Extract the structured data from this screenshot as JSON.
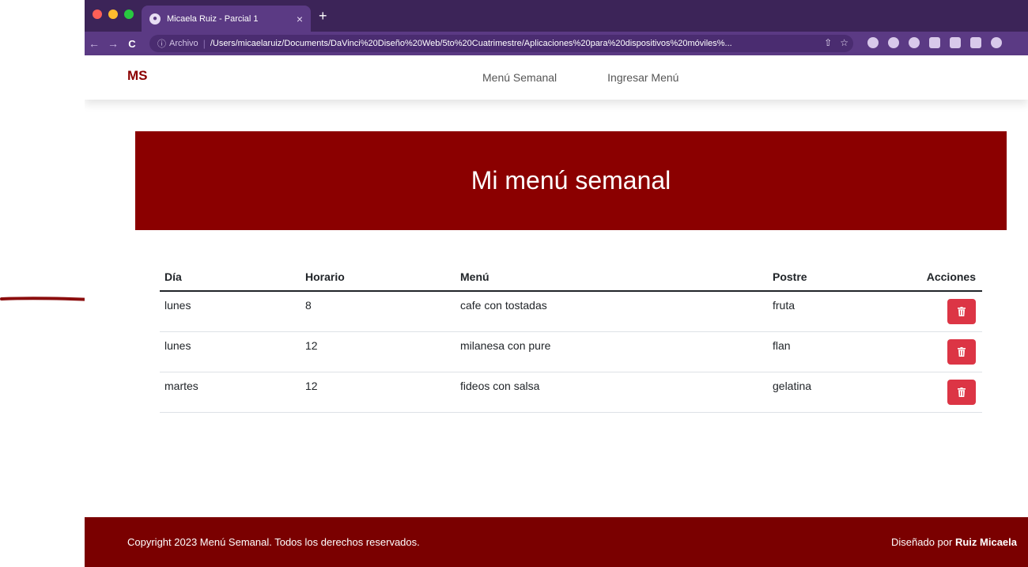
{
  "browser": {
    "tab_title": "Micaela Ruiz - Parcial 1",
    "tab_close": "×",
    "new_tab": "+",
    "back": "←",
    "forward": "→",
    "reload": "C",
    "address_info": "ⓘ",
    "address_scheme_label": "Archivo",
    "address_separator": "|",
    "url": "/Users/micaelaruiz/Documents/DaVinci%20Diseño%20Web/5to%20Cuatrimestre/Aplicaciones%20para%20dispositivos%20móviles%...",
    "share_icon": "⇧",
    "star_icon": "☆"
  },
  "navbar": {
    "brand": "MS",
    "links": [
      "Menú Semanal",
      "Ingresar Menú"
    ]
  },
  "hero": {
    "title": "Mi menú semanal"
  },
  "table": {
    "headers": [
      "Día",
      "Horario",
      "Menú",
      "Postre",
      "Acciones"
    ],
    "rows": [
      {
        "dia": "lunes",
        "horario": "8",
        "menu": "cafe con tostadas",
        "postre": "fruta"
      },
      {
        "dia": "lunes",
        "horario": "12",
        "menu": "milanesa con pure",
        "postre": "flan"
      },
      {
        "dia": "martes",
        "horario": "12",
        "menu": "fideos con salsa",
        "postre": "gelatina"
      }
    ]
  },
  "footer": {
    "copyright": "Copyright 2023 Menú Semanal. Todos los derechos reservados.",
    "designed_prefix": "Diseñado por ",
    "designer": "Ruiz Micaela"
  },
  "colors": {
    "brand": "#8b0000",
    "footer": "#7a0000",
    "delete_button": "#dc3545",
    "browser_frame": "#3c2458"
  },
  "icons": {
    "delete": "trash-icon"
  }
}
